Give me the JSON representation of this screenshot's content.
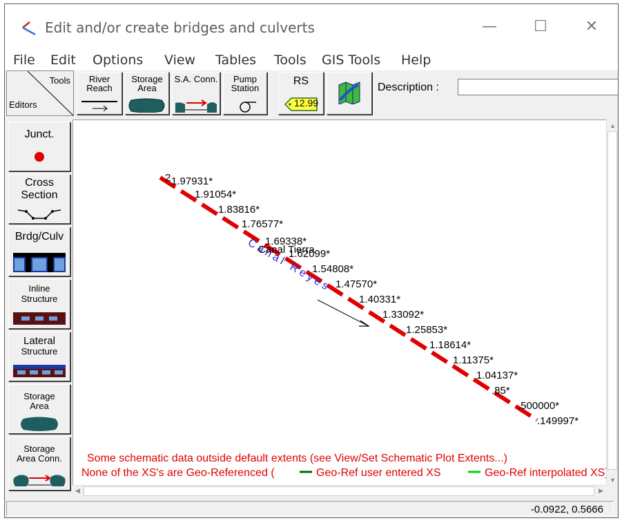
{
  "window": {
    "title": "Edit and/or create bridges and culverts",
    "minimize_glyph": "—",
    "maximize_glyph": "☐",
    "close_glyph": "✕"
  },
  "menu": [
    "File",
    "Edit",
    "Options",
    "View",
    "Tables",
    "Tools",
    "GIS Tools",
    "Help"
  ],
  "toolbar": {
    "corner_tools": "Tools",
    "corner_editors": "Editors",
    "river_reach": "River Reach",
    "storage_area": "Storage Area",
    "sa_conn": "S.A. Conn.",
    "pump_station": "Pump Station",
    "rs_label": "RS",
    "rs_value": "12.99",
    "description_label": "Description :",
    "description_value": ""
  },
  "editors": {
    "junct": "Junct.",
    "cross_section_1": "Cross",
    "cross_section_2": "Section",
    "brdg_culv": "Brdg/Culv",
    "inline_1": "Inline",
    "inline_2": "Structure",
    "lateral_1": "Lateral",
    "lateral_2": "Structure",
    "storage_area_1": "Storage",
    "storage_area_2": "Area",
    "sa_conn_1": "Storage",
    "sa_conn_2": "Area Conn."
  },
  "schematic": {
    "river_label": "Canal Reyes",
    "junction_label": "Canal Tierra",
    "reach_start_label": "2",
    "xs_labels": [
      "1.97931*",
      "1.91054*",
      "1.83816*",
      "1.76577*",
      "1.69338*",
      "1.62099*",
      "1.54808*",
      "1.47570*",
      "1.40331*",
      "1.33092*",
      "1.25853*",
      "1.18614*",
      "1.11375*",
      "1.04137*",
      ".85*",
      ".500000*",
      ".149997*"
    ],
    "message_1": "Some schematic data outside default extents (see View/Set Schematic Plot Extents...)",
    "message_2a": "None of the XS's are Geo-Referenced (",
    "message_2b": "Geo-Ref user entered XS",
    "message_2c": "Geo-Ref interpolated XS)",
    "colors": {
      "reach": "#e00000",
      "river_label": "#2b2be0",
      "message": "#e00000",
      "legend_dark_green": "#006400",
      "legend_green": "#00d000"
    }
  },
  "status": {
    "coords": "-0.0922, 0.5666"
  }
}
